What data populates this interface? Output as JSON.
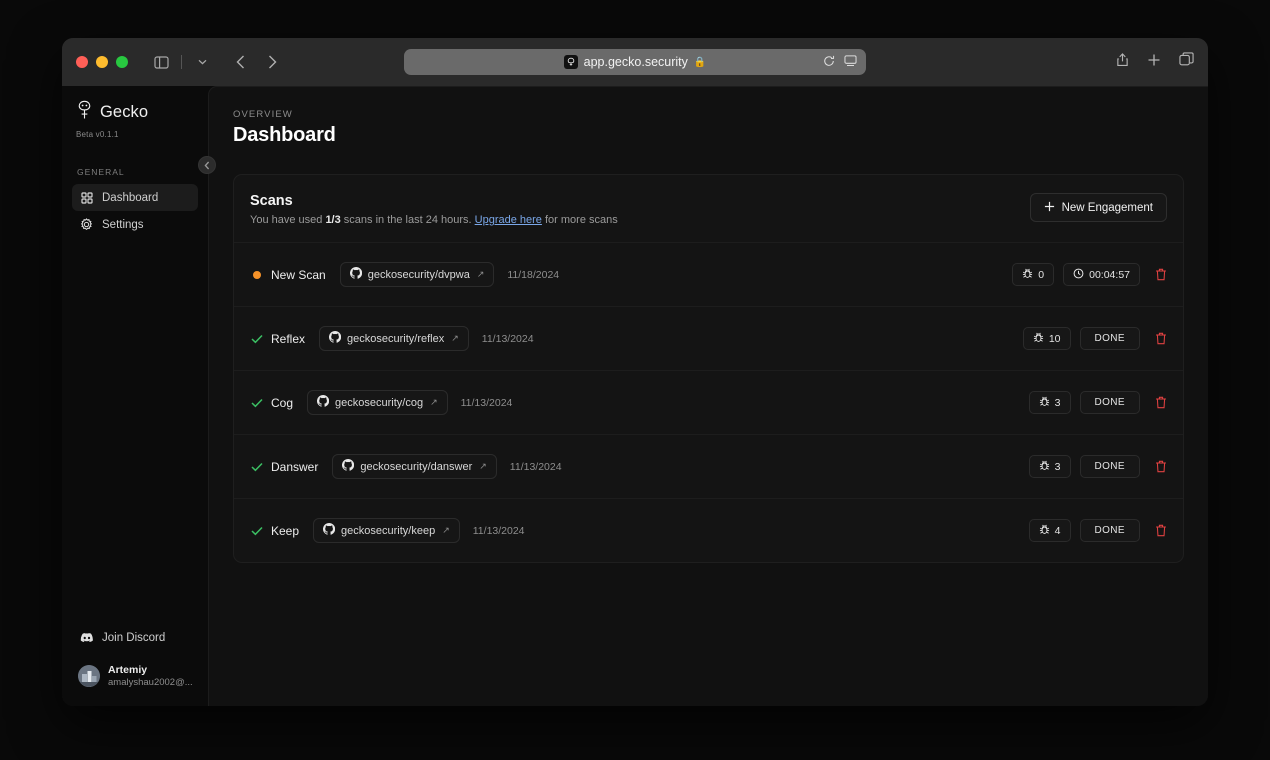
{
  "browser": {
    "url": "app.gecko.security",
    "favicon_icon": "gecko-favicon",
    "lock_icon": "lock-icon",
    "sidebar_toggle_icon": "sidebar-toggle-icon",
    "chevron_down_icon": "chevron-down-icon",
    "back_icon": "back-chevron-icon",
    "forward_icon": "forward-chevron-icon",
    "reload_icon": "reload-icon",
    "reader_icon": "reader-view-icon",
    "share_icon": "share-icon",
    "new_tab_icon": "plus-icon",
    "tabs_icon": "tab-overview-icon"
  },
  "sidebar": {
    "brand": "Gecko",
    "version": "Beta v0.1.1",
    "collapse_icon": "chevron-left-icon",
    "section_label": "GENERAL",
    "items": [
      {
        "label": "Dashboard",
        "icon": "grid-icon",
        "active": true
      },
      {
        "label": "Settings",
        "icon": "gear-icon",
        "active": false
      }
    ],
    "discord": {
      "label": "Join Discord",
      "icon": "discord-icon"
    },
    "user": {
      "name": "Artemiy",
      "email": "amalyshau2002@..."
    }
  },
  "main": {
    "eyebrow": "OVERVIEW",
    "title": "Dashboard",
    "card": {
      "title": "Scans",
      "subtitle_prefix": "You have used ",
      "subtitle_count": "1/3",
      "subtitle_middle": " scans in the last 24 hours. ",
      "subtitle_link": "Upgrade here",
      "subtitle_suffix": " for more scans",
      "new_engagement_label": "New Engagement",
      "new_engagement_icon": "plus-icon"
    },
    "rows": [
      {
        "status": "running",
        "status_icon": "orange-dot-icon",
        "name": "New Scan",
        "repo": "geckosecurity/dvpwa",
        "repo_icon": "github-icon",
        "external_icon": "external-link-icon",
        "date": "11/18/2024",
        "bug_count": "0",
        "bug_icon": "bug-icon",
        "secondary_pill": "00:04:57",
        "secondary_icon": "clock-icon",
        "delete_icon": "trash-icon"
      },
      {
        "status": "done",
        "status_icon": "check-icon",
        "name": "Reflex",
        "repo": "geckosecurity/reflex",
        "repo_icon": "github-icon",
        "external_icon": "external-link-icon",
        "date": "11/13/2024",
        "bug_count": "10",
        "bug_icon": "bug-icon",
        "secondary_pill": "DONE",
        "secondary_icon": "",
        "delete_icon": "trash-icon"
      },
      {
        "status": "done",
        "status_icon": "check-icon",
        "name": "Cog",
        "repo": "geckosecurity/cog",
        "repo_icon": "github-icon",
        "external_icon": "external-link-icon",
        "date": "11/13/2024",
        "bug_count": "3",
        "bug_icon": "bug-icon",
        "secondary_pill": "DONE",
        "secondary_icon": "",
        "delete_icon": "trash-icon"
      },
      {
        "status": "done",
        "status_icon": "check-icon",
        "name": "Danswer",
        "repo": "geckosecurity/danswer",
        "repo_icon": "github-icon",
        "external_icon": "external-link-icon",
        "date": "11/13/2024",
        "bug_count": "3",
        "bug_icon": "bug-icon",
        "secondary_pill": "DONE",
        "secondary_icon": "",
        "delete_icon": "trash-icon"
      },
      {
        "status": "done",
        "status_icon": "check-icon",
        "name": "Keep",
        "repo": "geckosecurity/keep",
        "repo_icon": "github-icon",
        "external_icon": "external-link-icon",
        "date": "11/13/2024",
        "bug_count": "4",
        "bug_icon": "bug-icon",
        "secondary_pill": "DONE",
        "secondary_icon": "",
        "delete_icon": "trash-icon"
      }
    ]
  },
  "colors": {
    "accent_orange": "#f59229",
    "accent_green": "#3bbf63",
    "danger_red": "#e04141",
    "link_blue": "#7aa7e8",
    "page_bg": "#111111",
    "card_bg": "#141414"
  }
}
